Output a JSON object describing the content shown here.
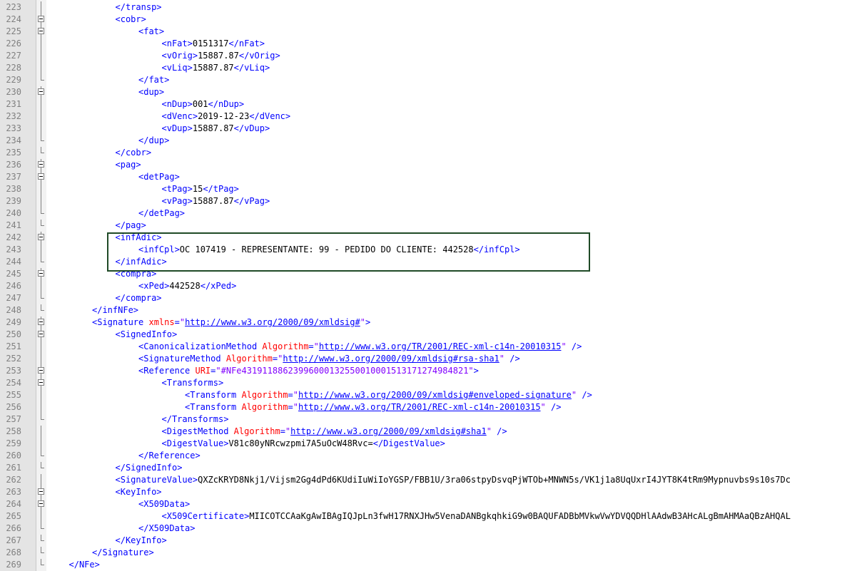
{
  "editor": {
    "lines": [
      {
        "n": "223",
        "i": 3,
        "f": "line",
        "p": [
          [
            "tag",
            "</transp>"
          ]
        ]
      },
      {
        "n": "224",
        "i": 3,
        "f": "open",
        "p": [
          [
            "tag",
            "<cobr>"
          ]
        ]
      },
      {
        "n": "225",
        "i": 4,
        "f": "open",
        "p": [
          [
            "tag",
            "<fat>"
          ]
        ]
      },
      {
        "n": "226",
        "i": 5,
        "f": "line",
        "p": [
          [
            "tag",
            "<nFat>"
          ],
          [
            "txt",
            "0151317"
          ],
          [
            "tag",
            "</nFat>"
          ]
        ]
      },
      {
        "n": "227",
        "i": 5,
        "f": "line",
        "p": [
          [
            "tag",
            "<vOrig>"
          ],
          [
            "txt",
            "15887.87"
          ],
          [
            "tag",
            "</vOrig>"
          ]
        ]
      },
      {
        "n": "228",
        "i": 5,
        "f": "line",
        "p": [
          [
            "tag",
            "<vLiq>"
          ],
          [
            "txt",
            "15887.87"
          ],
          [
            "tag",
            "</vLiq>"
          ]
        ]
      },
      {
        "n": "229",
        "i": 4,
        "f": "end",
        "p": [
          [
            "tag",
            "</fat>"
          ]
        ]
      },
      {
        "n": "230",
        "i": 4,
        "f": "open",
        "p": [
          [
            "tag",
            "<dup>"
          ]
        ]
      },
      {
        "n": "231",
        "i": 5,
        "f": "line",
        "p": [
          [
            "tag",
            "<nDup>"
          ],
          [
            "txt",
            "001"
          ],
          [
            "tag",
            "</nDup>"
          ]
        ]
      },
      {
        "n": "232",
        "i": 5,
        "f": "line",
        "p": [
          [
            "tag",
            "<dVenc>"
          ],
          [
            "txt",
            "2019-12-23"
          ],
          [
            "tag",
            "</dVenc>"
          ]
        ]
      },
      {
        "n": "233",
        "i": 5,
        "f": "line",
        "p": [
          [
            "tag",
            "<vDup>"
          ],
          [
            "txt",
            "15887.87"
          ],
          [
            "tag",
            "</vDup>"
          ]
        ]
      },
      {
        "n": "234",
        "i": 4,
        "f": "end",
        "p": [
          [
            "tag",
            "</dup>"
          ]
        ]
      },
      {
        "n": "235",
        "i": 3,
        "f": "end",
        "p": [
          [
            "tag",
            "</cobr>"
          ]
        ]
      },
      {
        "n": "236",
        "i": 3,
        "f": "open",
        "p": [
          [
            "tag",
            "<pag>"
          ]
        ]
      },
      {
        "n": "237",
        "i": 4,
        "f": "open",
        "p": [
          [
            "tag",
            "<detPag>"
          ]
        ]
      },
      {
        "n": "238",
        "i": 5,
        "f": "line",
        "p": [
          [
            "tag",
            "<tPag>"
          ],
          [
            "txt",
            "15"
          ],
          [
            "tag",
            "</tPag>"
          ]
        ]
      },
      {
        "n": "239",
        "i": 5,
        "f": "line",
        "p": [
          [
            "tag",
            "<vPag>"
          ],
          [
            "txt",
            "15887.87"
          ],
          [
            "tag",
            "</vPag>"
          ]
        ]
      },
      {
        "n": "240",
        "i": 4,
        "f": "end",
        "p": [
          [
            "tag",
            "</detPag>"
          ]
        ]
      },
      {
        "n": "241",
        "i": 3,
        "f": "end",
        "p": [
          [
            "tag",
            "</pag>"
          ]
        ]
      },
      {
        "n": "242",
        "i": 3,
        "f": "open",
        "p": [
          [
            "tag",
            "<infAdic>"
          ]
        ]
      },
      {
        "n": "243",
        "i": 4,
        "f": "line",
        "p": [
          [
            "tag",
            "<infCpl>"
          ],
          [
            "txt",
            "OC 107419 - REPRESENTANTE: 99 - PEDIDO DO CLIENTE: 442528"
          ],
          [
            "tag",
            "</infCpl>"
          ]
        ]
      },
      {
        "n": "244",
        "i": 3,
        "f": "end",
        "p": [
          [
            "tag",
            "</infAdic>"
          ]
        ]
      },
      {
        "n": "245",
        "i": 3,
        "f": "open",
        "p": [
          [
            "tag",
            "<compra>"
          ]
        ]
      },
      {
        "n": "246",
        "i": 4,
        "f": "line",
        "p": [
          [
            "tag",
            "<xPed>"
          ],
          [
            "txt",
            "442528"
          ],
          [
            "tag",
            "</xPed>"
          ]
        ]
      },
      {
        "n": "247",
        "i": 3,
        "f": "end",
        "p": [
          [
            "tag",
            "</compra>"
          ]
        ]
      },
      {
        "n": "248",
        "i": 2,
        "f": "end",
        "p": [
          [
            "tag",
            "</infNFe>"
          ]
        ]
      },
      {
        "n": "249",
        "i": 2,
        "f": "open",
        "p": [
          [
            "tag",
            "<Signature "
          ],
          [
            "attr",
            "xmlns"
          ],
          [
            "tag",
            "="
          ],
          [
            "val",
            "\""
          ],
          [
            "url",
            "http://www.w3.org/2000/09/xmldsig#"
          ],
          [
            "val",
            "\""
          ],
          [
            "tag",
            ">"
          ]
        ]
      },
      {
        "n": "250",
        "i": 3,
        "f": "open",
        "p": [
          [
            "tag",
            "<SignedInfo>"
          ]
        ]
      },
      {
        "n": "251",
        "i": 4,
        "f": "line",
        "p": [
          [
            "tag",
            "<CanonicalizationMethod "
          ],
          [
            "attr",
            "Algorithm"
          ],
          [
            "tag",
            "="
          ],
          [
            "val",
            "\""
          ],
          [
            "url",
            "http://www.w3.org/TR/2001/REC-xml-c14n-20010315"
          ],
          [
            "val",
            "\""
          ],
          [
            "tag",
            " />"
          ]
        ]
      },
      {
        "n": "252",
        "i": 4,
        "f": "line",
        "p": [
          [
            "tag",
            "<SignatureMethod "
          ],
          [
            "attr",
            "Algorithm"
          ],
          [
            "tag",
            "="
          ],
          [
            "val",
            "\""
          ],
          [
            "url",
            "http://www.w3.org/2000/09/xmldsig#rsa-sha1"
          ],
          [
            "val",
            "\""
          ],
          [
            "tag",
            " />"
          ]
        ]
      },
      {
        "n": "253",
        "i": 4,
        "f": "open",
        "p": [
          [
            "tag",
            "<Reference "
          ],
          [
            "attr",
            "URI"
          ],
          [
            "tag",
            "="
          ],
          [
            "val",
            "\"#NFe43191188623996000132550010001513171274984821\""
          ],
          [
            "tag",
            ">"
          ]
        ]
      },
      {
        "n": "254",
        "i": 5,
        "f": "open",
        "p": [
          [
            "tag",
            "<Transforms>"
          ]
        ]
      },
      {
        "n": "255",
        "i": 6,
        "f": "line",
        "p": [
          [
            "tag",
            "<Transform "
          ],
          [
            "attr",
            "Algorithm"
          ],
          [
            "tag",
            "="
          ],
          [
            "val",
            "\""
          ],
          [
            "url",
            "http://www.w3.org/2000/09/xmldsig#enveloped-signature"
          ],
          [
            "val",
            "\""
          ],
          [
            "tag",
            " />"
          ]
        ]
      },
      {
        "n": "256",
        "i": 6,
        "f": "line",
        "p": [
          [
            "tag",
            "<Transform "
          ],
          [
            "attr",
            "Algorithm"
          ],
          [
            "tag",
            "="
          ],
          [
            "val",
            "\""
          ],
          [
            "url",
            "http://www.w3.org/TR/2001/REC-xml-c14n-20010315"
          ],
          [
            "val",
            "\""
          ],
          [
            "tag",
            " />"
          ]
        ]
      },
      {
        "n": "257",
        "i": 5,
        "f": "end",
        "p": [
          [
            "tag",
            "</Transforms>"
          ]
        ]
      },
      {
        "n": "258",
        "i": 5,
        "f": "line",
        "p": [
          [
            "tag",
            "<DigestMethod "
          ],
          [
            "attr",
            "Algorithm"
          ],
          [
            "tag",
            "="
          ],
          [
            "val",
            "\""
          ],
          [
            "url",
            "http://www.w3.org/2000/09/xmldsig#sha1"
          ],
          [
            "val",
            "\""
          ],
          [
            "tag",
            " />"
          ]
        ]
      },
      {
        "n": "259",
        "i": 5,
        "f": "line",
        "p": [
          [
            "tag",
            "<DigestValue>"
          ],
          [
            "txt",
            "V81c80yNRcwzpmi7A5uOcW48Rvc="
          ],
          [
            "tag",
            "</DigestValue>"
          ]
        ]
      },
      {
        "n": "260",
        "i": 4,
        "f": "end",
        "p": [
          [
            "tag",
            "</Reference>"
          ]
        ]
      },
      {
        "n": "261",
        "i": 3,
        "f": "end",
        "p": [
          [
            "tag",
            "</SignedInfo>"
          ]
        ]
      },
      {
        "n": "262",
        "i": 3,
        "f": "line",
        "p": [
          [
            "tag",
            "<SignatureValue>"
          ],
          [
            "txt",
            "QXZcKRYD8Nkj1/Vijsm2Gg4dPd6KUdiIuWiIoYGSP/FBB1U/3ra06stpyDsvqPjWTOb+MNWN5s/VK1j1a8UqUxrI4JYT8K4tRm9Mypnuvbs9s10s7Dc"
          ]
        ]
      },
      {
        "n": "263",
        "i": 3,
        "f": "open",
        "p": [
          [
            "tag",
            "<KeyInfo>"
          ]
        ]
      },
      {
        "n": "264",
        "i": 4,
        "f": "open",
        "p": [
          [
            "tag",
            "<X509Data>"
          ]
        ]
      },
      {
        "n": "265",
        "i": 5,
        "f": "line",
        "p": [
          [
            "tag",
            "<X509Certificate>"
          ],
          [
            "txt",
            "MIICOTCCAaKgAwIBAgIQJpLn3fwH17RNXJHw5VenaDANBgkqhkiG9w0BAQUFADBbMVkwVwYDVQQDHlAAdwB3AHcALgBmAHMAaQBzAHQAL"
          ]
        ]
      },
      {
        "n": "266",
        "i": 4,
        "f": "end",
        "p": [
          [
            "tag",
            "</X509Data>"
          ]
        ]
      },
      {
        "n": "267",
        "i": 3,
        "f": "end",
        "p": [
          [
            "tag",
            "</KeyInfo>"
          ]
        ]
      },
      {
        "n": "268",
        "i": 2,
        "f": "end",
        "p": [
          [
            "tag",
            "</Signature>"
          ]
        ]
      },
      {
        "n": "269",
        "i": 1,
        "f": "end",
        "p": [
          [
            "tag",
            "</NFe>"
          ]
        ]
      }
    ]
  }
}
